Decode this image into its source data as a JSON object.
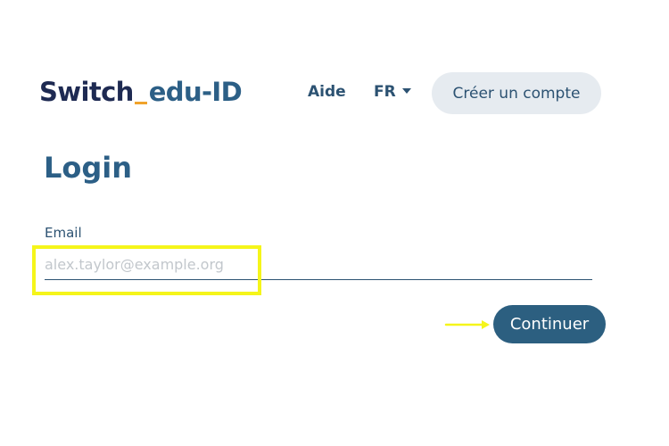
{
  "header": {
    "logo": {
      "part1": "Switch",
      "part2": "edu-ID"
    },
    "help_label": "Aide",
    "language": "FR",
    "create_account_label": "Créer un compte"
  },
  "main": {
    "title": "Login",
    "email": {
      "label": "Email",
      "placeholder": "alex.taylor@example.org",
      "value": ""
    },
    "continue_label": "Continuer"
  },
  "annotations": {
    "highlight_color": "#f5f51a",
    "arrow_color": "#f5f51a"
  },
  "colors": {
    "brand_dark": "#1e2a52",
    "brand_blue": "#2c5f86",
    "accent_orange": "#f0a32b",
    "button_bg": "#2c5f80",
    "secondary_button_bg": "#e6ebf0"
  }
}
